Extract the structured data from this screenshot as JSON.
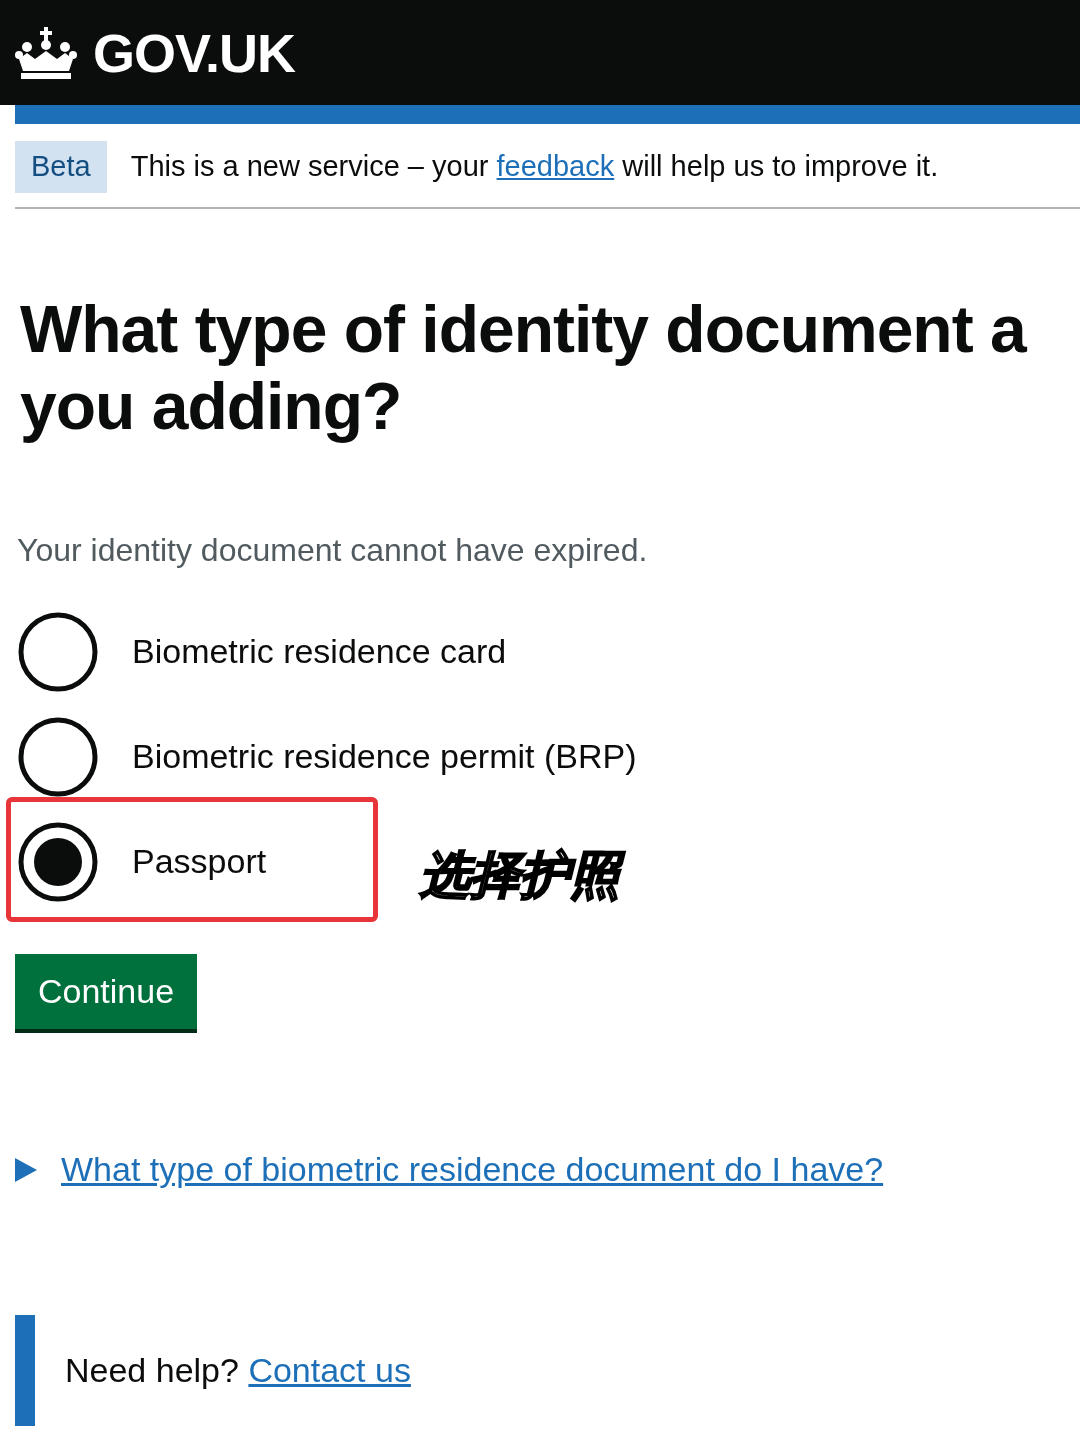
{
  "header": {
    "logo_text": "GOV.UK"
  },
  "phase_banner": {
    "tag": "Beta",
    "text_before": "This is a new service – your ",
    "link": "feedback",
    "text_after": " will help us to improve it."
  },
  "question": {
    "heading_lines": [
      "What type of identity document a",
      "you adding?"
    ],
    "hint": "Your identity document cannot have expired.",
    "options": [
      {
        "label": "Biometric residence card",
        "selected": false,
        "highlighted": false
      },
      {
        "label": "Biometric residence permit (BRP)",
        "selected": false,
        "highlighted": false
      },
      {
        "label": "Passport",
        "selected": true,
        "highlighted": true
      }
    ]
  },
  "annotation": {
    "text": "选择护照"
  },
  "continue_button": "Continue",
  "details": {
    "summary": "What type of biometric residence document do I have?",
    "expanded": false
  },
  "help": {
    "text": "Need help? ",
    "link": "Contact us"
  }
}
